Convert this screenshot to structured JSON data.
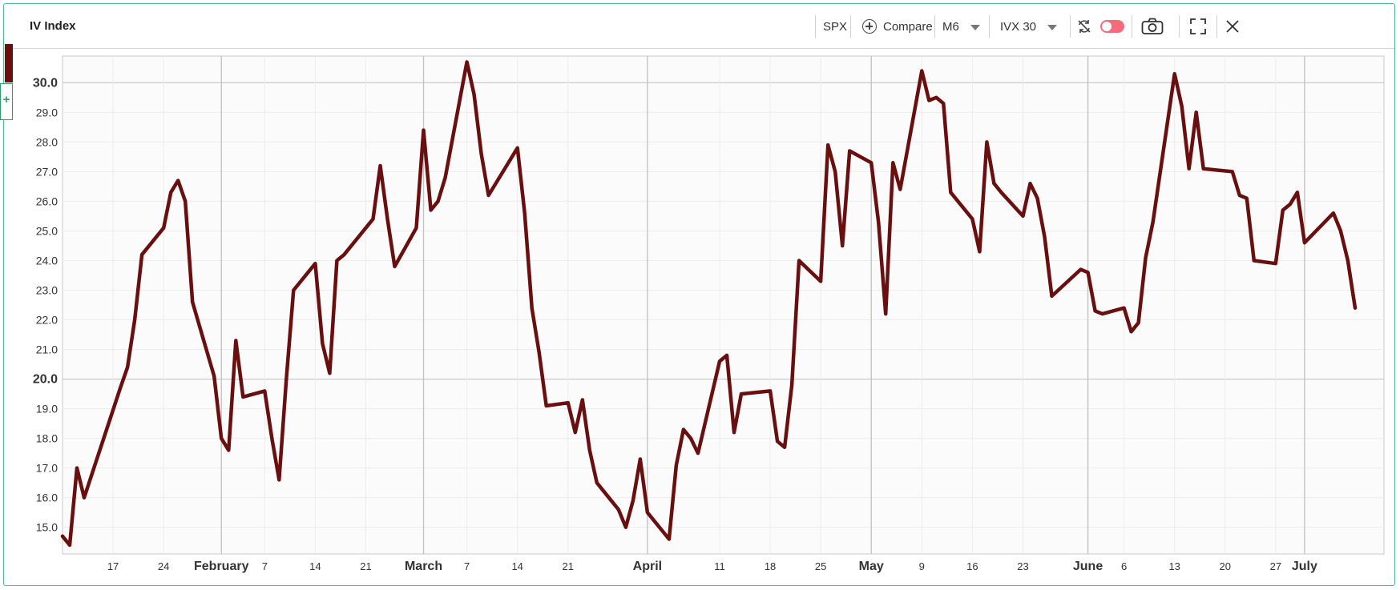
{
  "header": {
    "title": "IV Index",
    "symbol": "SPX",
    "compare_label": "Compare",
    "period": "M6",
    "indicator": "IVX 30"
  },
  "icons": {
    "compare": "plus-circle-icon",
    "sync": "sync-off-icon",
    "toggle": "toggle-icon",
    "camera": "camera-icon",
    "fullscreen": "fullscreen-icon",
    "close": "close-icon"
  },
  "colors": {
    "series": "#6a0f0f",
    "accent": "#2e9e6e",
    "toggle": "#f56b7a"
  },
  "chart_data": {
    "type": "line",
    "ylim": [
      14.1,
      30.9
    ],
    "y_ticks": [
      {
        "value": 15,
        "label": "15.0",
        "major": false
      },
      {
        "value": 16,
        "label": "16.0",
        "major": false
      },
      {
        "value": 17,
        "label": "17.0",
        "major": false
      },
      {
        "value": 18,
        "label": "18.0",
        "major": false
      },
      {
        "value": 19,
        "label": "19.0",
        "major": false
      },
      {
        "value": 20,
        "label": "20.0",
        "major": true
      },
      {
        "value": 21,
        "label": "21.0",
        "major": false
      },
      {
        "value": 22,
        "label": "22.0",
        "major": false
      },
      {
        "value": 23,
        "label": "23.0",
        "major": false
      },
      {
        "value": 24,
        "label": "24.0",
        "major": false
      },
      {
        "value": 25,
        "label": "25.0",
        "major": false
      },
      {
        "value": 26,
        "label": "26.0",
        "major": false
      },
      {
        "value": 27,
        "label": "27.0",
        "major": false
      },
      {
        "value": 28,
        "label": "28.0",
        "major": false
      },
      {
        "value": 29,
        "label": "29.0",
        "major": false
      },
      {
        "value": 30,
        "label": "30.0",
        "major": true
      }
    ],
    "x_ticks": [
      {
        "date": "2022-01-17",
        "label": "17",
        "major": false
      },
      {
        "date": "2022-01-24",
        "label": "24",
        "major": false
      },
      {
        "date": "2022-02-01",
        "label": "February",
        "major": true
      },
      {
        "date": "2022-02-07",
        "label": "7",
        "major": false
      },
      {
        "date": "2022-02-14",
        "label": "14",
        "major": false
      },
      {
        "date": "2022-02-21",
        "label": "21",
        "major": false
      },
      {
        "date": "2022-03-01",
        "label": "March",
        "major": true
      },
      {
        "date": "2022-03-07",
        "label": "7",
        "major": false
      },
      {
        "date": "2022-03-14",
        "label": "14",
        "major": false
      },
      {
        "date": "2022-03-21",
        "label": "21",
        "major": false
      },
      {
        "date": "2022-04-01",
        "label": "April",
        "major": true
      },
      {
        "date": "2022-04-11",
        "label": "11",
        "major": false
      },
      {
        "date": "2022-04-18",
        "label": "18",
        "major": false
      },
      {
        "date": "2022-04-25",
        "label": "25",
        "major": false
      },
      {
        "date": "2022-05-02",
        "label": "May",
        "major": true
      },
      {
        "date": "2022-05-09",
        "label": "9",
        "major": false
      },
      {
        "date": "2022-05-16",
        "label": "16",
        "major": false
      },
      {
        "date": "2022-05-23",
        "label": "23",
        "major": false
      },
      {
        "date": "2022-06-01",
        "label": "June",
        "major": true
      },
      {
        "date": "2022-06-06",
        "label": "6",
        "major": false
      },
      {
        "date": "2022-06-13",
        "label": "13",
        "major": false
      },
      {
        "date": "2022-06-20",
        "label": "20",
        "major": false
      },
      {
        "date": "2022-06-27",
        "label": "27",
        "major": false
      },
      {
        "date": "2022-07-01",
        "label": "July",
        "major": true
      }
    ],
    "xlim": [
      "2022-01-10",
      "2022-07-12"
    ],
    "grid": true,
    "series": [
      {
        "points": [
          [
            "2022-01-10",
            14.7
          ],
          [
            "2022-01-11",
            14.4
          ],
          [
            "2022-01-12",
            17.0
          ],
          [
            "2022-01-13",
            16.0
          ],
          [
            "2022-01-18",
            19.7
          ],
          [
            "2022-01-19",
            20.4
          ],
          [
            "2022-01-20",
            22.0
          ],
          [
            "2022-01-21",
            24.2
          ],
          [
            "2022-01-24",
            25.1
          ],
          [
            "2022-01-25",
            26.3
          ],
          [
            "2022-01-26",
            26.7
          ],
          [
            "2022-01-27",
            26.0
          ],
          [
            "2022-01-28",
            22.6
          ],
          [
            "2022-01-31",
            20.1
          ],
          [
            "2022-02-01",
            18.0
          ],
          [
            "2022-02-02",
            17.6
          ],
          [
            "2022-02-03",
            21.3
          ],
          [
            "2022-02-04",
            19.4
          ],
          [
            "2022-02-07",
            19.6
          ],
          [
            "2022-02-08",
            18.0
          ],
          [
            "2022-02-09",
            16.6
          ],
          [
            "2022-02-10",
            20.0
          ],
          [
            "2022-02-11",
            23.0
          ],
          [
            "2022-02-14",
            23.9
          ],
          [
            "2022-02-15",
            21.2
          ],
          [
            "2022-02-16",
            20.2
          ],
          [
            "2022-02-17",
            24.0
          ],
          [
            "2022-02-18",
            24.2
          ],
          [
            "2022-02-22",
            25.4
          ],
          [
            "2022-02-23",
            27.2
          ],
          [
            "2022-02-24",
            25.4
          ],
          [
            "2022-02-25",
            23.8
          ],
          [
            "2022-02-28",
            25.1
          ],
          [
            "2022-03-01",
            28.4
          ],
          [
            "2022-03-02",
            25.7
          ],
          [
            "2022-03-03",
            26.0
          ],
          [
            "2022-03-04",
            26.8
          ],
          [
            "2022-03-07",
            30.7
          ],
          [
            "2022-03-08",
            29.6
          ],
          [
            "2022-03-09",
            27.6
          ],
          [
            "2022-03-10",
            26.2
          ],
          [
            "2022-03-14",
            27.8
          ],
          [
            "2022-03-15",
            25.6
          ],
          [
            "2022-03-16",
            22.4
          ],
          [
            "2022-03-17",
            20.9
          ],
          [
            "2022-03-18",
            19.1
          ],
          [
            "2022-03-21",
            19.2
          ],
          [
            "2022-03-22",
            18.2
          ],
          [
            "2022-03-23",
            19.3
          ],
          [
            "2022-03-24",
            17.6
          ],
          [
            "2022-03-25",
            16.5
          ],
          [
            "2022-03-28",
            15.6
          ],
          [
            "2022-03-29",
            15.0
          ],
          [
            "2022-03-30",
            15.9
          ],
          [
            "2022-03-31",
            17.3
          ],
          [
            "2022-04-01",
            15.5
          ],
          [
            "2022-04-04",
            14.6
          ],
          [
            "2022-04-05",
            17.1
          ],
          [
            "2022-04-06",
            18.3
          ],
          [
            "2022-04-07",
            18.0
          ],
          [
            "2022-04-08",
            17.5
          ],
          [
            "2022-04-11",
            20.6
          ],
          [
            "2022-04-12",
            20.8
          ],
          [
            "2022-04-13",
            18.2
          ],
          [
            "2022-04-14",
            19.5
          ],
          [
            "2022-04-18",
            19.6
          ],
          [
            "2022-04-19",
            17.9
          ],
          [
            "2022-04-20",
            17.7
          ],
          [
            "2022-04-21",
            19.8
          ],
          [
            "2022-04-22",
            24.0
          ],
          [
            "2022-04-25",
            23.3
          ],
          [
            "2022-04-26",
            27.9
          ],
          [
            "2022-04-27",
            27.0
          ],
          [
            "2022-04-28",
            24.5
          ],
          [
            "2022-04-29",
            27.7
          ],
          [
            "2022-05-02",
            27.3
          ],
          [
            "2022-05-03",
            25.3
          ],
          [
            "2022-05-04",
            22.2
          ],
          [
            "2022-05-05",
            27.3
          ],
          [
            "2022-05-06",
            26.4
          ],
          [
            "2022-05-09",
            30.4
          ],
          [
            "2022-05-10",
            29.4
          ],
          [
            "2022-05-11",
            29.5
          ],
          [
            "2022-05-12",
            29.3
          ],
          [
            "2022-05-13",
            26.3
          ],
          [
            "2022-05-16",
            25.4
          ],
          [
            "2022-05-17",
            24.3
          ],
          [
            "2022-05-18",
            28.0
          ],
          [
            "2022-05-19",
            26.6
          ],
          [
            "2022-05-20",
            26.3
          ],
          [
            "2022-05-23",
            25.5
          ],
          [
            "2022-05-24",
            26.6
          ],
          [
            "2022-05-25",
            26.1
          ],
          [
            "2022-05-26",
            24.8
          ],
          [
            "2022-05-27",
            22.8
          ],
          [
            "2022-05-31",
            23.7
          ],
          [
            "2022-06-01",
            23.6
          ],
          [
            "2022-06-02",
            22.3
          ],
          [
            "2022-06-03",
            22.2
          ],
          [
            "2022-06-06",
            22.4
          ],
          [
            "2022-06-07",
            21.6
          ],
          [
            "2022-06-08",
            21.9
          ],
          [
            "2022-06-09",
            24.1
          ],
          [
            "2022-06-10",
            25.3
          ],
          [
            "2022-06-13",
            30.3
          ],
          [
            "2022-06-14",
            29.2
          ],
          [
            "2022-06-15",
            27.1
          ],
          [
            "2022-06-16",
            29.0
          ],
          [
            "2022-06-17",
            27.1
          ],
          [
            "2022-06-21",
            27.0
          ],
          [
            "2022-06-22",
            26.2
          ],
          [
            "2022-06-23",
            26.1
          ],
          [
            "2022-06-24",
            24.0
          ],
          [
            "2022-06-27",
            23.9
          ],
          [
            "2022-06-28",
            25.7
          ],
          [
            "2022-06-29",
            25.9
          ],
          [
            "2022-06-30",
            26.3
          ],
          [
            "2022-07-01",
            24.6
          ],
          [
            "2022-07-05",
            25.6
          ],
          [
            "2022-07-06",
            25.0
          ],
          [
            "2022-07-07",
            24.0
          ],
          [
            "2022-07-08",
            22.4
          ]
        ]
      }
    ]
  }
}
